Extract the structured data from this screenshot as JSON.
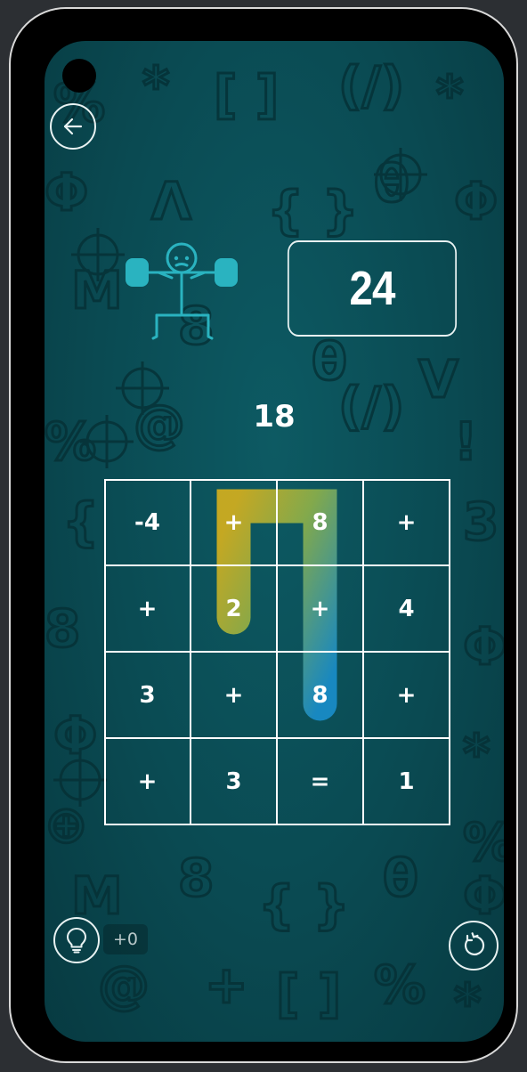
{
  "target": "24",
  "current_value": "18",
  "hint_count": "+0",
  "grid": [
    [
      "-4",
      "+",
      "8",
      "+"
    ],
    [
      "+",
      "2",
      "+",
      "4"
    ],
    [
      "3",
      "+",
      "8",
      "+"
    ],
    [
      "+",
      "3",
      "=",
      "1"
    ]
  ],
  "selected_path": [
    [
      1,
      1
    ],
    [
      0,
      1
    ],
    [
      0,
      2
    ],
    [
      1,
      2
    ],
    [
      2,
      2
    ]
  ],
  "colors": {
    "background": "#0a4a52",
    "path_start": "#d4b020",
    "path_end": "#1e90c8",
    "accent": "#2ab3c0",
    "text": "#ffffff"
  },
  "icons": {
    "back": "arrow-left-icon",
    "hint": "lightbulb-icon",
    "restart": "restart-icon",
    "character": "weightlifter-icon"
  }
}
